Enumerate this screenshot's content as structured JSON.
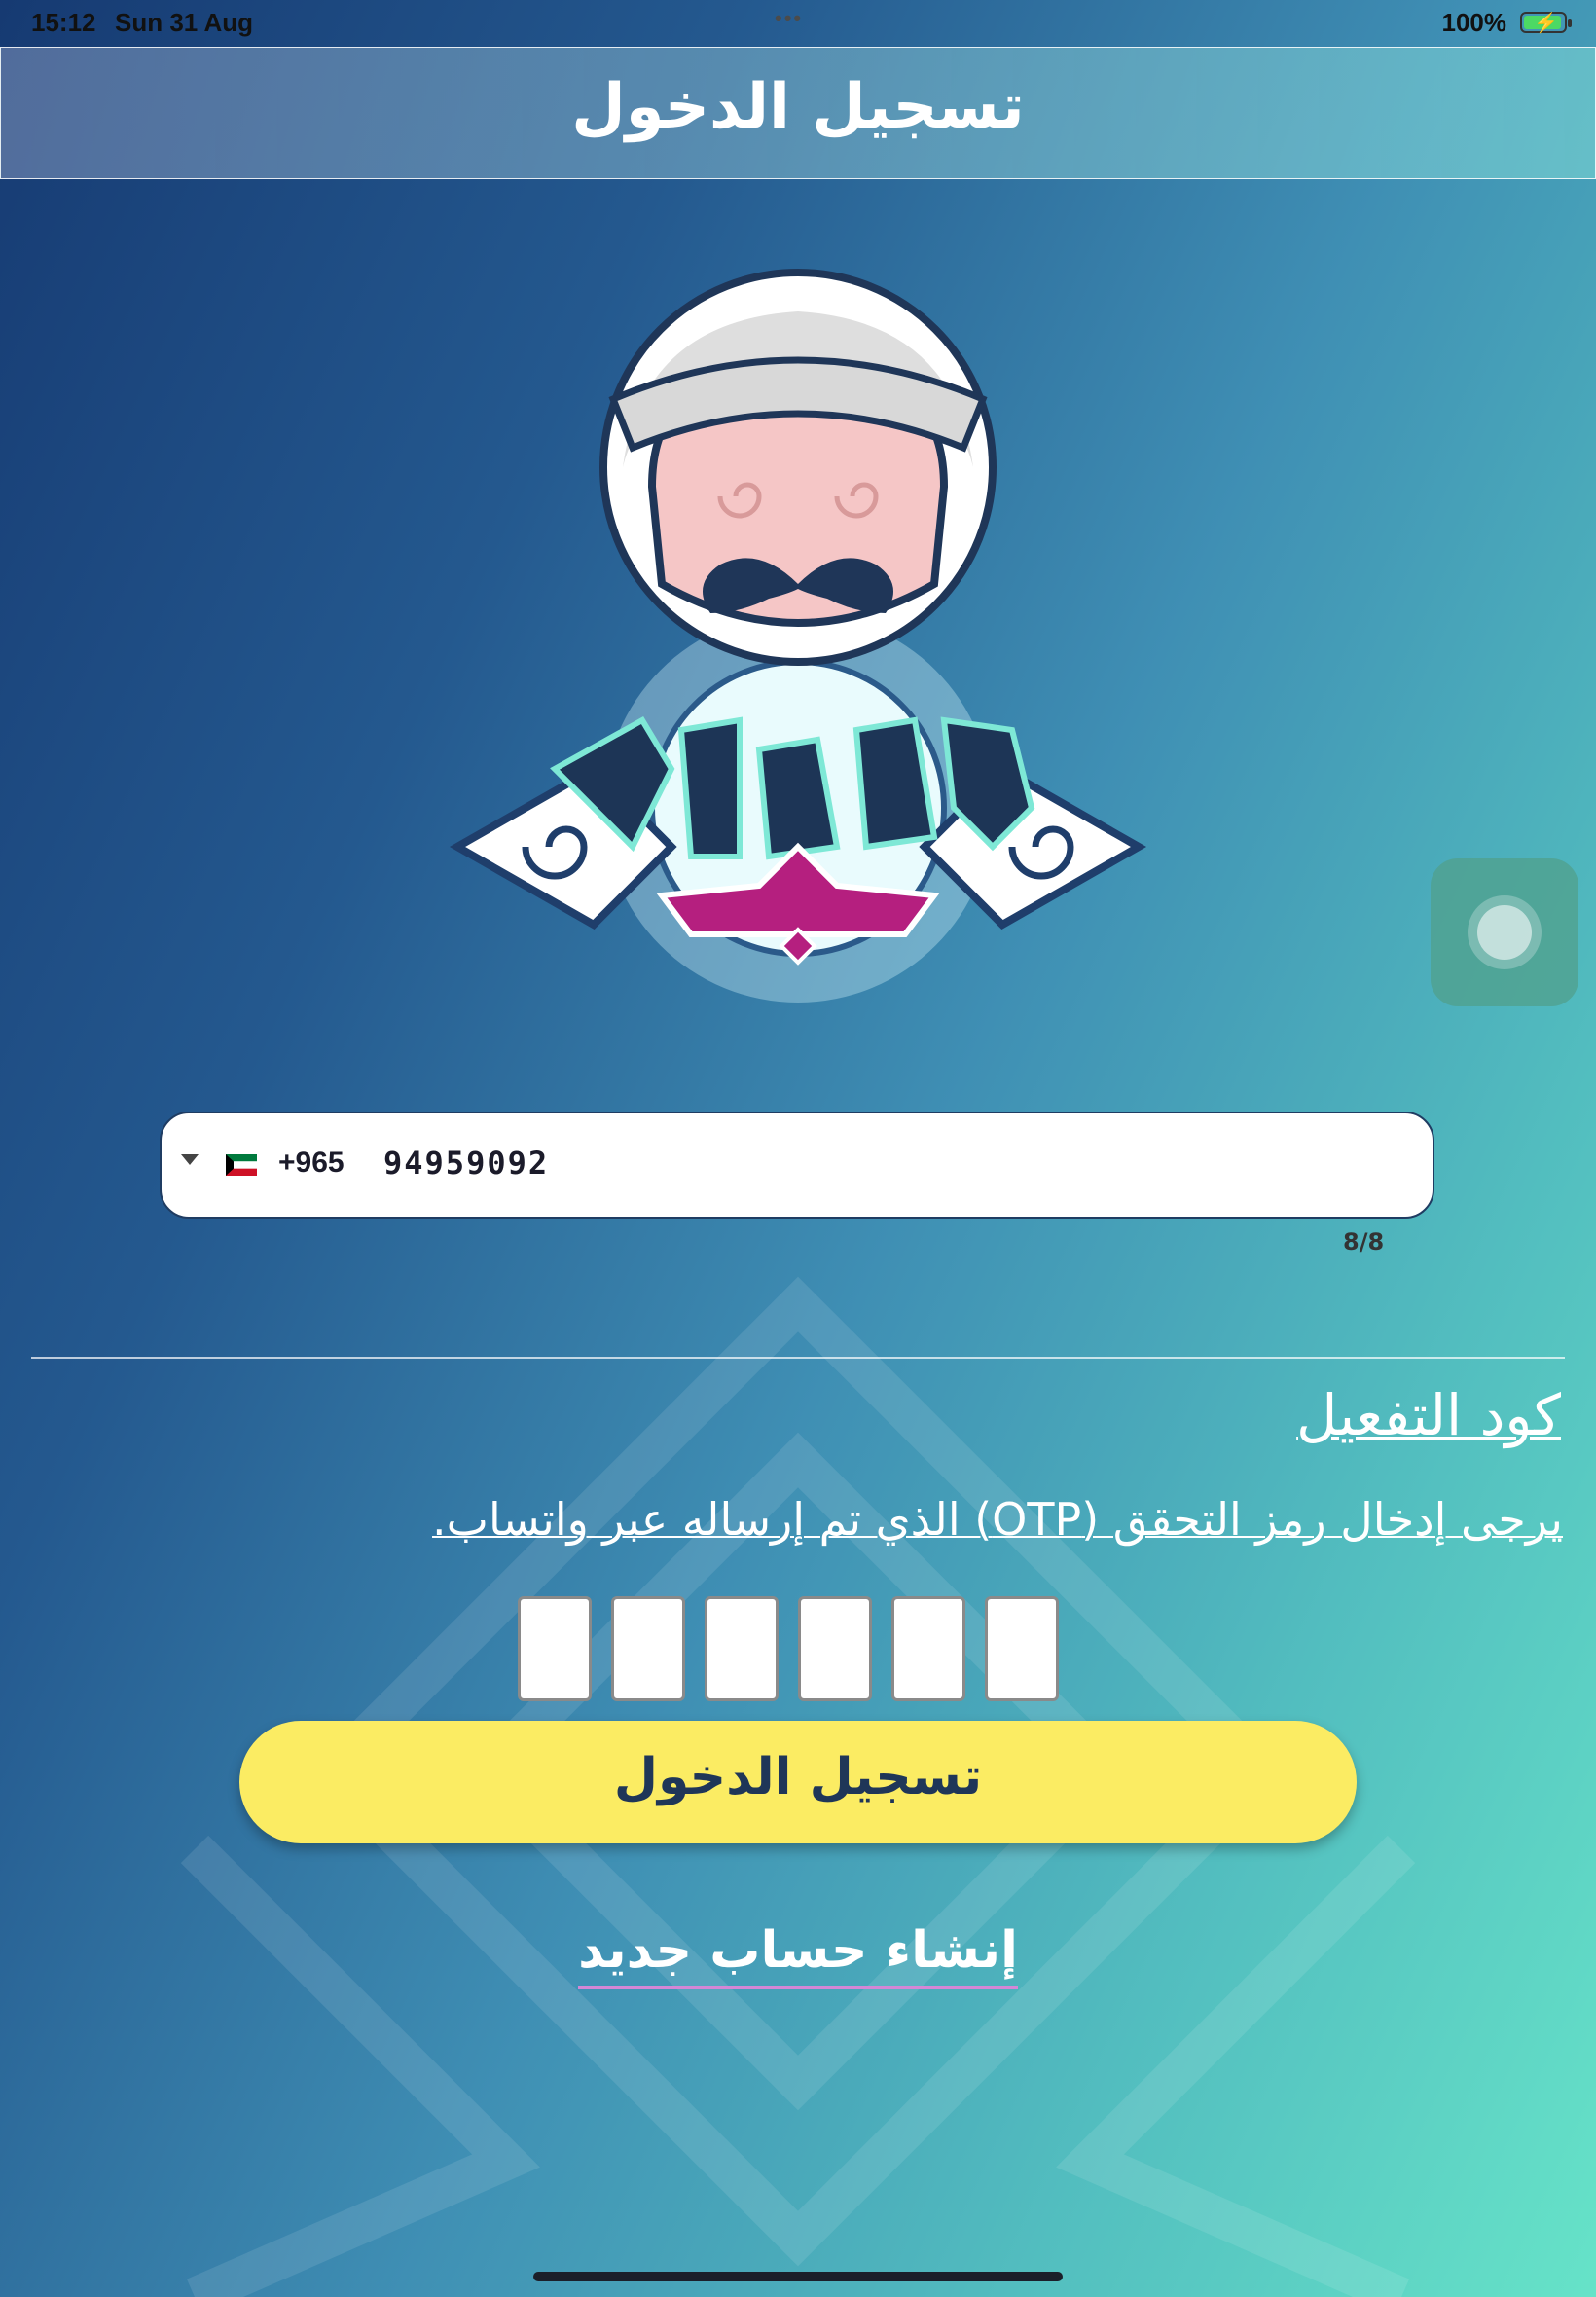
{
  "status_bar": {
    "time": "15:12",
    "date": "Sun 31 Aug",
    "multitask_dots": "•••",
    "battery_percent": "100%",
    "battery_level": 1.0,
    "charging": true
  },
  "header": {
    "title": "تسجيل الدخول"
  },
  "logo": {
    "icon": "mascot-logo"
  },
  "phone_input": {
    "country_code": "+965",
    "number": "94959092",
    "counter": "8/8",
    "flag_icon": "kuwait-flag-icon"
  },
  "activation": {
    "title": "كود التفعيل",
    "instruction": "يرجى إدخال رمز التحقق (OTP) الذي تم إرساله عبر واتساب.",
    "otp_boxes": [
      "",
      "",
      "",
      "",
      "",
      ""
    ]
  },
  "buttons": {
    "login": "تسجيل الدخول",
    "register": "إنشاء حساب جديد"
  },
  "colors": {
    "login_button": "#fbec63",
    "gradient_start": "#163a72",
    "gradient_end": "#66e3c8",
    "link_underline": "#d487d6"
  }
}
